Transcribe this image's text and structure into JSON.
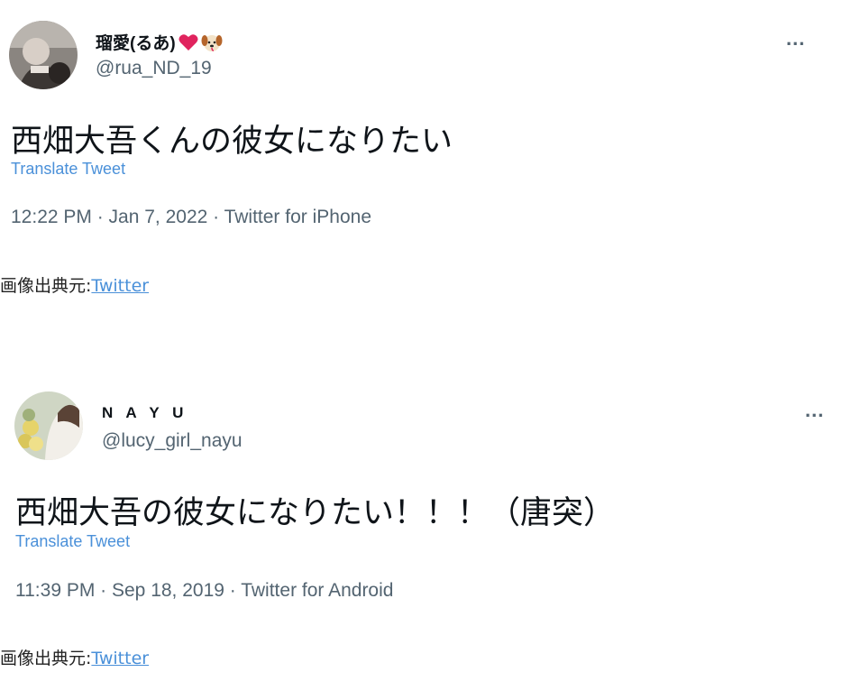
{
  "tweets": [
    {
      "display_name": "瑠愛(るあ)",
      "emojis": [
        "heart-emoji",
        "dog-emoji"
      ],
      "handle": "@rua_ND_19",
      "more_label": "...",
      "text": "西畑大吾くんの彼女になりたい",
      "translate_label": "Translate Tweet",
      "meta": "12:22 PM · Jan 7, 2022 · Twitter for iPhone"
    },
    {
      "display_name": "N A Y U",
      "handle": "@lucy_girl_nayu",
      "more_label": "...",
      "text": "西畑大吾の彼女になりたい！！！（唐突）",
      "translate_label": "Translate Tweet",
      "meta": "11:39 PM · Sep 18, 2019 · Twitter for Android"
    }
  ],
  "sources": [
    {
      "prefix": "画像出典元:",
      "link": "Twitter"
    },
    {
      "prefix": "画像出典元:",
      "link": "Twitter"
    }
  ],
  "colors": {
    "link": "#4a90d9",
    "secondary_text": "#536471",
    "primary_text": "#0f1419",
    "heart": "#e0245e"
  }
}
